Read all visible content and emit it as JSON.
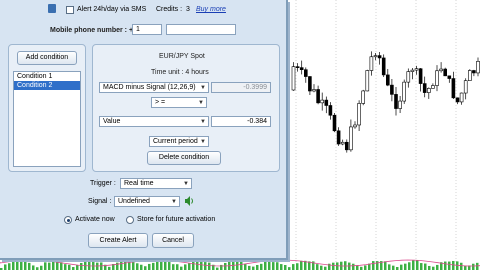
{
  "colors": {
    "dialog_bg": "#d7e4f2",
    "bull_candle": "#ffffff",
    "bear_candle": "#000000",
    "histogram": "#3cb043",
    "accent_link": "#1a3fb5"
  },
  "alert": {
    "sms_checkbox_label": "Alert 24h/day via SMS",
    "credits_label": "Credits :",
    "credits_value": "3",
    "buy_more_link": "Buy more",
    "phone_label": "Mobile phone number : +",
    "phone_value": "1"
  },
  "conditions": {
    "add_button": "Add condition",
    "items": [
      "Condition 1",
      "Condition 2"
    ],
    "selected_index": 1
  },
  "condition_panel": {
    "title": "EUR/JPY Spot",
    "time_unit": "Time unit : 4 hours",
    "indicator": "MACD minus Signal (12,26,9)",
    "indicator_value": "-0.3999",
    "operator": "> =",
    "compare": "Value",
    "compare_value": "-0.384",
    "period": "Current period",
    "delete_button": "Delete condition"
  },
  "trigger": {
    "label": "Trigger :",
    "value": "Real time"
  },
  "signal": {
    "label": "Signal :",
    "value": "Undefined",
    "icon": "speaker-icon"
  },
  "activation": {
    "options": [
      "Activate now",
      "Store for future activation"
    ],
    "selected_index": 0
  },
  "buttons": {
    "create": "Create Alert",
    "cancel": "Cancel"
  }
}
